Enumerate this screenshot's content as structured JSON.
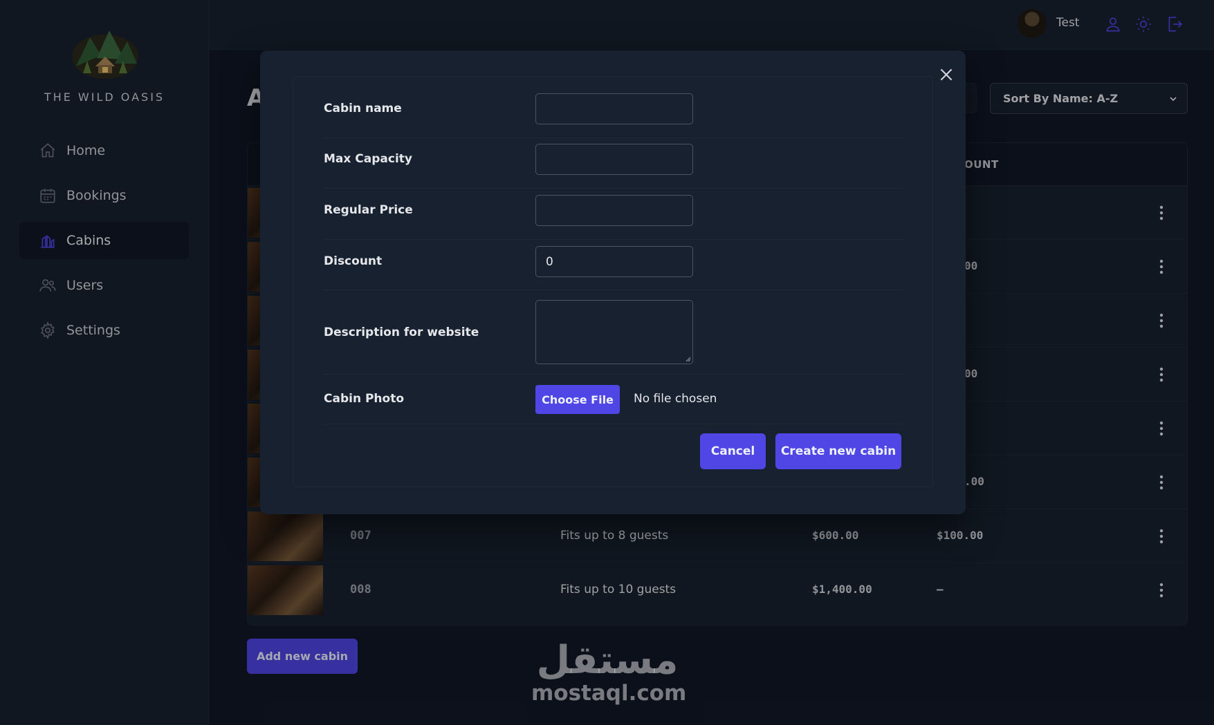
{
  "brand": {
    "name": "THE WILD OASIS"
  },
  "sidebar": {
    "items": [
      {
        "label": "Home",
        "icon": "home-icon"
      },
      {
        "label": "Bookings",
        "icon": "calendar-icon"
      },
      {
        "label": "Cabins",
        "icon": "chart-icon",
        "active": true
      },
      {
        "label": "Users",
        "icon": "users-icon"
      },
      {
        "label": "Settings",
        "icon": "gear-icon"
      }
    ]
  },
  "header": {
    "user_name": "Test",
    "icons": [
      "user-icon",
      "sun-icon",
      "logout-icon"
    ]
  },
  "main": {
    "title": "A",
    "sort": {
      "selected": "Sort By Name: A-Z"
    },
    "table_header_fragment": "OUNT",
    "rows": [
      {
        "discount_fragment": ""
      },
      {
        "discount_fragment": "00"
      },
      {
        "discount_fragment": ""
      },
      {
        "discount_fragment": "00"
      },
      {
        "discount_fragment": ""
      },
      {
        "discount_fragment": ".00"
      },
      {
        "cabin": "007",
        "capacity": "Fits up to 8 guests",
        "price": "$600.00",
        "discount": "$100.00"
      },
      {
        "cabin": "008",
        "capacity": "Fits up to 10 guests",
        "price": "$1,400.00",
        "discount": "—"
      }
    ],
    "add_button": "Add new cabin"
  },
  "modal": {
    "fields": {
      "cabin_name": {
        "label": "Cabin name",
        "value": ""
      },
      "max_capacity": {
        "label": "Max Capacity",
        "value": ""
      },
      "regular_price": {
        "label": "Regular Price",
        "value": ""
      },
      "discount": {
        "label": "Discount",
        "value": "0"
      },
      "description": {
        "label": "Description for website",
        "value": ""
      },
      "photo": {
        "label": "Cabin Photo",
        "button": "Choose File",
        "status": "No file chosen"
      }
    },
    "cancel": "Cancel",
    "submit": "Create new cabin"
  },
  "watermark": {
    "arabic": "مستقل",
    "latin": "mostaql.com"
  },
  "colors": {
    "accent": "#4f46e5",
    "sidebar": "#18212f",
    "background": "#111827",
    "icon_accent": "#4f46e5"
  }
}
